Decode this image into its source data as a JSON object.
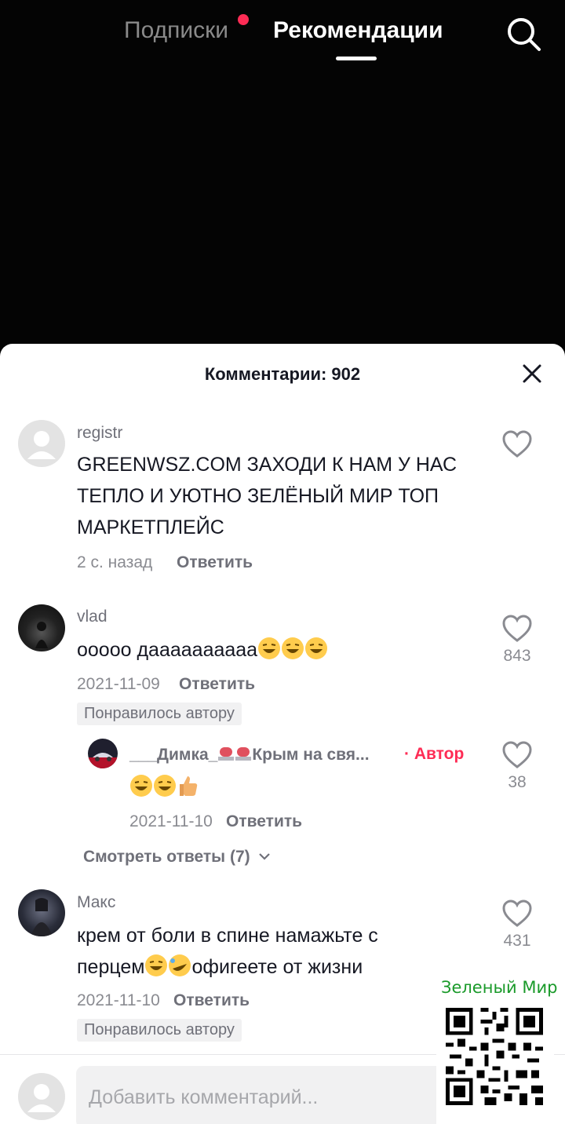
{
  "nav": {
    "tab_following": "Подписки",
    "tab_recommended": "Рекомендации"
  },
  "colors": {
    "accent": "#fe2c55",
    "watermark_green": "#1a9a2a"
  },
  "comments_sheet": {
    "title": "Комментарии: 902",
    "input_placeholder": "Добавить комментарий..."
  },
  "comments": [
    {
      "username": "registr",
      "text_lines": [
        "GREENWSZ.COM ЗАХОДИ К НАМ У НАС",
        "ТЕПЛО И УЮТНО ЗЕЛЁНЫЙ МИР ТОП",
        "МАРКЕТПЛЕЙС"
      ],
      "time": "2 с. назад",
      "reply_label": "Ответить",
      "likes": ""
    },
    {
      "username": "vlad",
      "text": "ооооо даааааааааа",
      "emojis": [
        "grinning-sweat-icon",
        "grinning-sweat-icon",
        "grinning-sweat-icon"
      ],
      "time": "2021-11-09",
      "reply_label": "Ответить",
      "likes": "843",
      "badge": "Понравилось автору",
      "reply": {
        "username": "___Димка_",
        "username_suffix": "Крым на свя...",
        "author_tag": "· Автор",
        "emojis": [
          "grinning-sweat-icon",
          "grinning-sweat-icon",
          "thumbs-up-icon"
        ],
        "time": "2021-11-10",
        "reply_label": "Ответить",
        "likes": "38"
      },
      "view_replies": "Смотреть ответы (7)"
    },
    {
      "username": "Макс",
      "text_line1": "крем от боли в спине намажьте с",
      "text_line2_a": "перцем",
      "text_line2_b": "офигеете от жизни",
      "time": "2021-11-10",
      "reply_label": "Ответить",
      "likes": "431",
      "badge": "Понравилось автору"
    }
  ],
  "watermark": {
    "text": "Зеленый Мир"
  }
}
